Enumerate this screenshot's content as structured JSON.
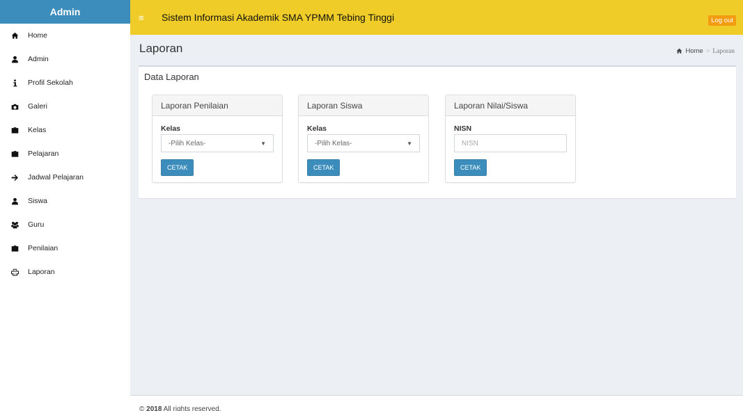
{
  "sidebar": {
    "brand": "Admin",
    "items": [
      {
        "label": "Home",
        "icon": "home-icon"
      },
      {
        "label": "Admin",
        "icon": "user-icon"
      },
      {
        "label": "Profil Sekolah",
        "icon": "info-icon"
      },
      {
        "label": "Galeri",
        "icon": "camera-icon"
      },
      {
        "label": "Kelas",
        "icon": "briefcase-icon"
      },
      {
        "label": "Pelajaran",
        "icon": "briefcase-icon"
      },
      {
        "label": "Jadwal Pelajaran",
        "icon": "arrow-right-icon"
      },
      {
        "label": "Siswa",
        "icon": "user-icon"
      },
      {
        "label": "Guru",
        "icon": "users-icon"
      },
      {
        "label": "Penilaian",
        "icon": "briefcase-icon"
      },
      {
        "label": "Laporan",
        "icon": "print-icon"
      }
    ]
  },
  "header": {
    "toggle": "≡",
    "title": "Sistem Informasi Akademik SMA YPMM Tebing Tinggi",
    "logout": "Log out",
    "color": "#efcc28"
  },
  "page": {
    "title": "Laporan",
    "breadcrumb": {
      "home": "Home",
      "separator": ">",
      "current": "Laporan"
    }
  },
  "box": {
    "title": "Data Laporan",
    "panels": [
      {
        "heading": "Laporan Penilaian",
        "label": "Kelas",
        "type": "select",
        "value": "-Pilih Kelas-",
        "button": "CETAK"
      },
      {
        "heading": "Laporan Siswa",
        "label": "Kelas",
        "type": "select",
        "value": "-Pilih Kelas-",
        "button": "CETAK"
      },
      {
        "heading": "Laporan Nilai/Siswa",
        "label": "NISN",
        "type": "input",
        "placeholder": "NISN",
        "button": "CETAK"
      }
    ]
  },
  "footer": {
    "prefix": "©",
    "year": "2018",
    "text": "All rights reserved."
  },
  "colors": {
    "primary": "#3c8dbc",
    "header": "#efcc28",
    "logout": "#f39c12",
    "content_bg": "#ecf0f5"
  }
}
